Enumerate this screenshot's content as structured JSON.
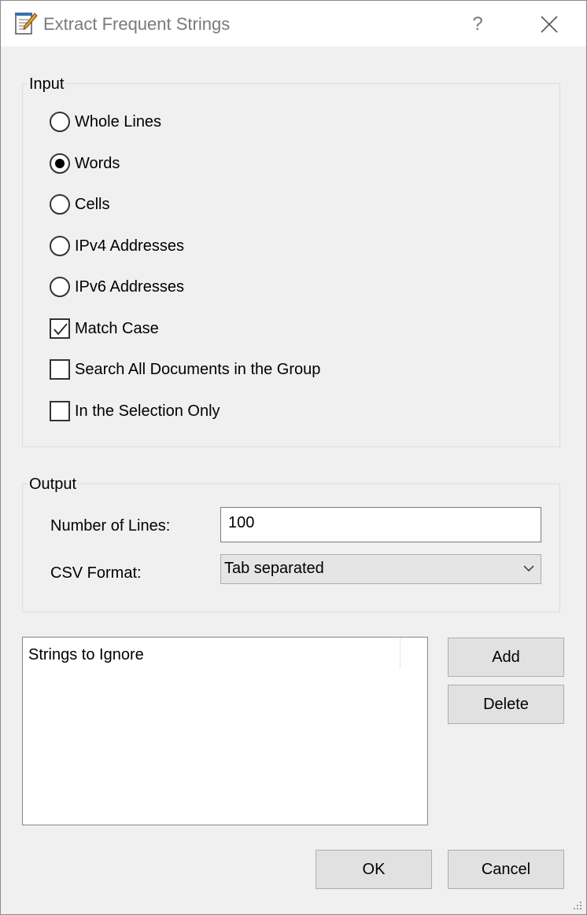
{
  "window": {
    "title": "Extract Frequent Strings",
    "help_glyph": "?"
  },
  "input_group": {
    "label": "Input",
    "options": [
      {
        "label": "Whole Lines",
        "type": "radio",
        "checked": false
      },
      {
        "label": "Words",
        "type": "radio",
        "checked": true
      },
      {
        "label": "Cells",
        "type": "radio",
        "checked": false
      },
      {
        "label": "IPv4 Addresses",
        "type": "radio",
        "checked": false
      },
      {
        "label": "IPv6 Addresses",
        "type": "radio",
        "checked": false
      },
      {
        "label": "Match Case",
        "type": "checkbox",
        "checked": true
      },
      {
        "label": "Search All Documents in the Group",
        "type": "checkbox",
        "checked": false
      },
      {
        "label": "In the Selection Only",
        "type": "checkbox",
        "checked": false
      }
    ]
  },
  "output_group": {
    "label": "Output",
    "number_of_lines_label": "Number of Lines:",
    "number_of_lines_value": "100",
    "csv_format_label": "CSV Format:",
    "csv_format_value": "Tab separated"
  },
  "ignore_list": {
    "header": "Strings to Ignore",
    "items": []
  },
  "buttons": {
    "add": "Add",
    "delete": "Delete",
    "ok": "OK",
    "cancel": "Cancel"
  },
  "icons": {
    "app": "notepad-pencil-icon",
    "close": "close-icon",
    "dropdown": "chevron-down-icon",
    "checkmark": "checkmark-icon",
    "grip": "resize-grip-icon"
  }
}
